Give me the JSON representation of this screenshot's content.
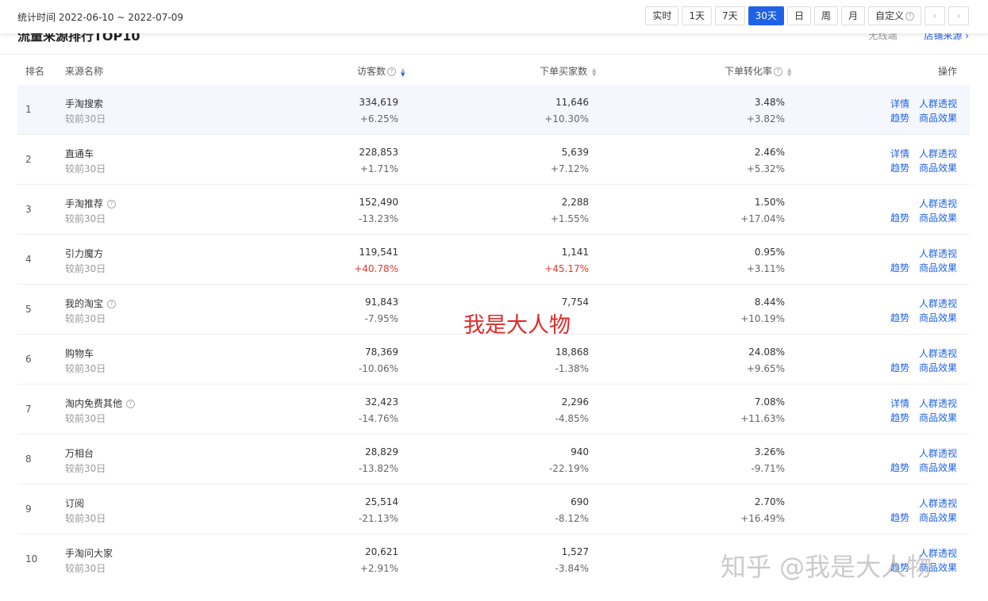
{
  "stat_time": "统计时间 2022-06-10 ~ 2022-07-09",
  "range_buttons": [
    "实时",
    "1天",
    "7天",
    "30天",
    "日",
    "周",
    "月",
    "自定义"
  ],
  "active_range": "30天",
  "nav": {
    "prev": "‹",
    "next": "›"
  },
  "section": {
    "title": "流量来源排行TOP10",
    "select_label": "无线端",
    "link_label": "店铺来源 ›"
  },
  "table": {
    "headers": {
      "rank": "排名",
      "name": "来源名称",
      "visitors": "访客数",
      "buyers": "下单买家数",
      "rate": "下单转化率",
      "ops": "操作"
    },
    "ops_labels": {
      "detail": "详情",
      "crowd": "人群透视",
      "trend": "趋势",
      "goods": "商品效果"
    },
    "rows": [
      {
        "rank": "1",
        "name": "手淘搜索",
        "sub": "较前30日",
        "visitors": "334,619",
        "visitors_chg": "+6.25%",
        "buyers": "11,646",
        "buyers_chg": "+10.30%",
        "rate": "3.48%",
        "rate_chg": "+3.82%"
      },
      {
        "rank": "2",
        "name": "直通车",
        "sub": "较前30日",
        "visitors": "228,853",
        "visitors_chg": "+1.71%",
        "buyers": "5,639",
        "buyers_chg": "+7.12%",
        "rate": "2.46%",
        "rate_chg": "+5.32%"
      },
      {
        "rank": "3",
        "name": "手淘推荐",
        "sub": "较前30日",
        "visitors": "152,490",
        "visitors_chg": "-13.23%",
        "buyers": "2,288",
        "buyers_chg": "+1.55%",
        "rate": "1.50%",
        "rate_chg": "+17.04%"
      },
      {
        "rank": "4",
        "name": "引力魔方",
        "sub": "较前30日",
        "visitors": "119,541",
        "visitors_chg": "+40.78%",
        "buyers": "1,141",
        "buyers_chg": "+45.17%",
        "rate": "0.95%",
        "rate_chg": "+3.11%"
      },
      {
        "rank": "5",
        "name": "我的淘宝",
        "sub": "较前30日",
        "visitors": "91,843",
        "visitors_chg": "-7.95%",
        "buyers": "7,754",
        "buyers_chg": "",
        "rate": "8.44%",
        "rate_chg": "+10.19%"
      },
      {
        "rank": "6",
        "name": "购物车",
        "sub": "较前30日",
        "visitors": "78,369",
        "visitors_chg": "-10.06%",
        "buyers": "18,868",
        "buyers_chg": "-1.38%",
        "rate": "24.08%",
        "rate_chg": "+9.65%"
      },
      {
        "rank": "7",
        "name": "淘内免费其他",
        "sub": "较前30日",
        "visitors": "32,423",
        "visitors_chg": "-14.76%",
        "buyers": "2,296",
        "buyers_chg": "-4.85%",
        "rate": "7.08%",
        "rate_chg": "+11.63%"
      },
      {
        "rank": "8",
        "name": "万相台",
        "sub": "较前30日",
        "visitors": "28,829",
        "visitors_chg": "-13.82%",
        "buyers": "940",
        "buyers_chg": "-22.19%",
        "rate": "3.26%",
        "rate_chg": "-9.71%"
      },
      {
        "rank": "9",
        "name": "订阅",
        "sub": "较前30日",
        "visitors": "25,514",
        "visitors_chg": "-21.13%",
        "buyers": "690",
        "buyers_chg": "-8.12%",
        "rate": "2.70%",
        "rate_chg": "+16.49%"
      },
      {
        "rank": "10",
        "name": "手淘问大家",
        "sub": "较前30日",
        "visitors": "20,621",
        "visitors_chg": "+2.91%",
        "buyers": "1,527",
        "buyers_chg": "-3.84%",
        "rate": "",
        "rate_chg": ""
      }
    ]
  },
  "watermark_center": "我是大人物",
  "watermark_corner": "知乎 @我是大人物",
  "colors": {
    "accent": "#2062e6",
    "red": "#e6382d",
    "watermark_red": "#e02a2a"
  }
}
